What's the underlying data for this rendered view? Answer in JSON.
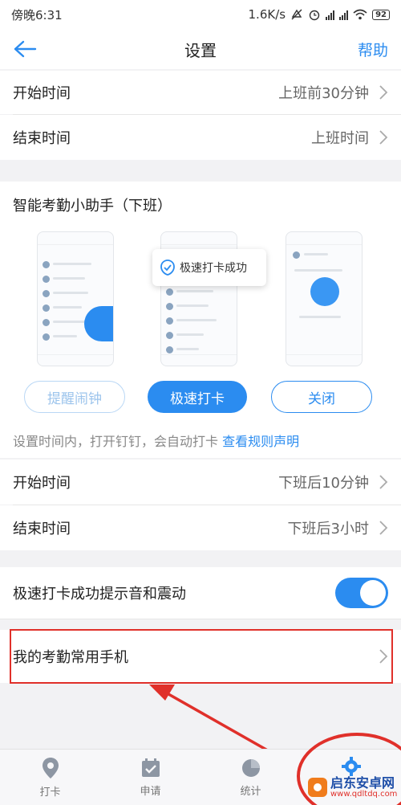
{
  "status_bar": {
    "time": "傍晚6:31",
    "speed": "1.6K/s",
    "battery": "92"
  },
  "header": {
    "title": "设置",
    "help_label": "帮助"
  },
  "work_section": {
    "rows": [
      {
        "label": "开始时间",
        "value": "上班前30分钟"
      },
      {
        "label": "结束时间",
        "value": "上班时间"
      }
    ]
  },
  "assistant": {
    "title": "智能考勤小助手（下班）",
    "bubble_text": "极速打卡成功",
    "options": {
      "remind": "提醒闹钟",
      "fast": "极速打卡",
      "close": "关闭"
    },
    "selected": "极速打卡",
    "rule_text": "设置时间内，打开钉钉，会自动打卡",
    "rule_link": "查看规则声明"
  },
  "off_section": {
    "rows": [
      {
        "label": "开始时间",
        "value": "下班后10分钟"
      },
      {
        "label": "结束时间",
        "value": "下班后3小时"
      }
    ]
  },
  "sound_setting": {
    "label": "极速打卡成功提示音和震动",
    "enabled": true
  },
  "phone_setting": {
    "label": "我的考勤常用手机"
  },
  "tabbar": {
    "items": [
      {
        "label": "打卡",
        "icon": "location-pin-icon"
      },
      {
        "label": "申请",
        "icon": "calendar-check-icon"
      },
      {
        "label": "统计",
        "icon": "pie-chart-icon"
      },
      {
        "label": "",
        "icon": "gear-icon"
      }
    ]
  },
  "watermark": {
    "main": "启东安卓网",
    "sub": "www.qdltdq.com"
  },
  "colors": {
    "accent": "#2b8cf0",
    "annotation": "#e0302a"
  }
}
